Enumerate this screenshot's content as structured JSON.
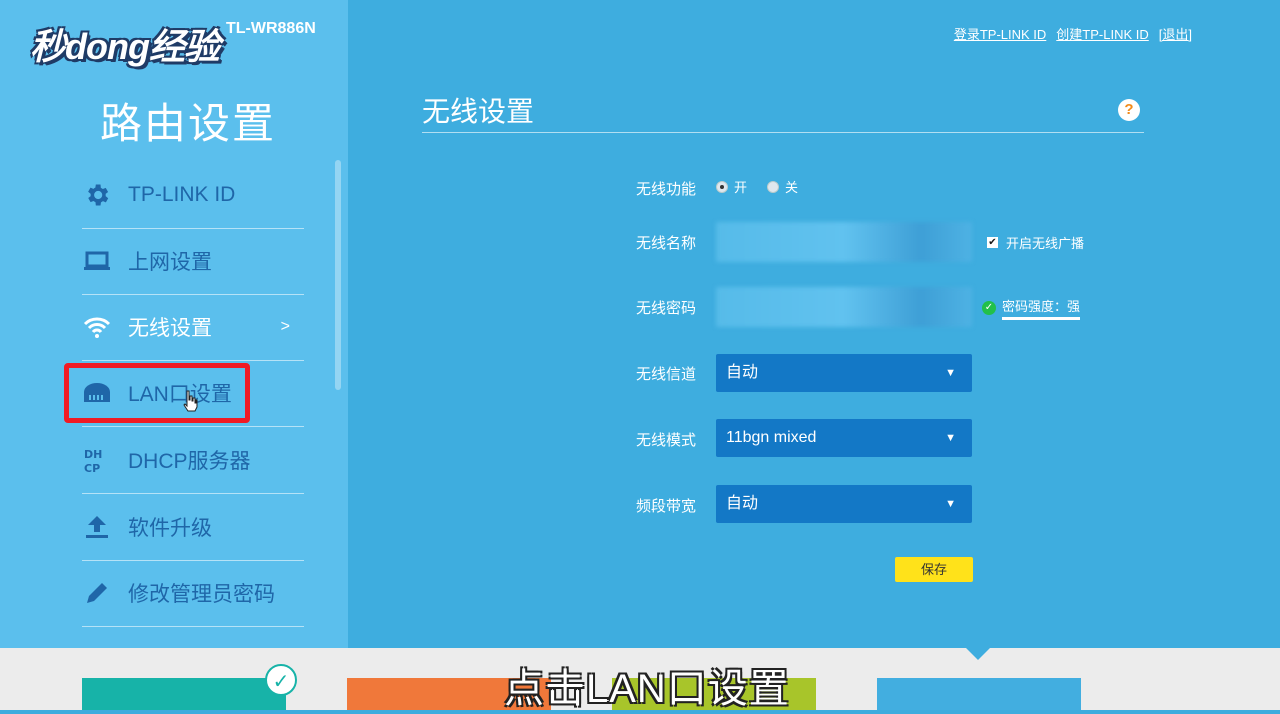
{
  "watermark": "秒dong经验",
  "model": "TL-WR886N",
  "brand_title": "路由设置",
  "top_links": [
    "登录TP-LINK ID",
    "创建TP-LINK ID",
    "[退出]"
  ],
  "sidebar": {
    "items": [
      {
        "label": "TP-LINK ID",
        "icon": "gear-icon"
      },
      {
        "label": "上网设置",
        "icon": "laptop-icon"
      },
      {
        "label": "无线设置",
        "icon": "wifi-icon",
        "chevron": ">"
      },
      {
        "label": "LAN口设置",
        "icon": "router-icon"
      },
      {
        "label": "DHCP服务器",
        "icon": "dhcp-icon"
      },
      {
        "label": "软件升级",
        "icon": "upload-icon"
      },
      {
        "label": "修改管理员密码",
        "icon": "pencil-icon"
      }
    ]
  },
  "main": {
    "title": "无线设置",
    "help": "?",
    "wireless_func": {
      "label": "无线功能",
      "on": "开",
      "off": "关",
      "selected": "开"
    },
    "ssid": {
      "label": "无线名称",
      "broadcast_label": "开启无线广播"
    },
    "password": {
      "label": "无线密码",
      "strength": "密码强度：强"
    },
    "channel": {
      "label": "无线信道",
      "value": "自动"
    },
    "mode": {
      "label": "无线模式",
      "value": "11bgn mixed"
    },
    "bandwidth": {
      "label": "频段带宽",
      "value": "自动"
    },
    "save": "保存"
  },
  "subtitle": "点击LAN口设置",
  "colors": {
    "sidebar_bg": "#5bbfed",
    "main_bg": "#3eaddf",
    "select_bg": "#1378c6",
    "save_bg": "#ffe21a",
    "highlight": "#f01a24"
  }
}
